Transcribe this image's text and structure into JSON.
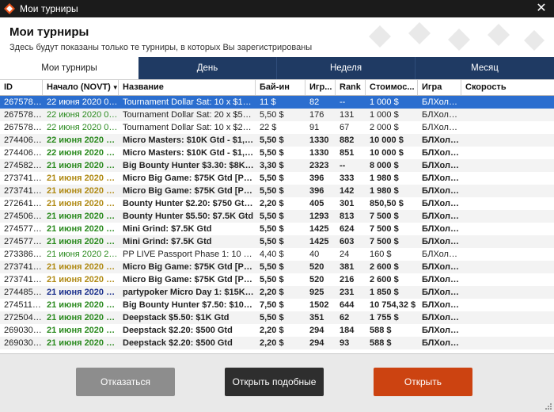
{
  "window": {
    "title": "Мои турниры",
    "close_glyph": "✕",
    "icon": "app-logo-icon"
  },
  "header": {
    "title": "Мои турниры",
    "subtitle": "Здесь будут показаны только те турниры, в которых Вы зарегистрированы"
  },
  "tabs": [
    {
      "label": "Мои турниры",
      "active": true
    },
    {
      "label": "День",
      "active": false
    },
    {
      "label": "Неделя",
      "active": false
    },
    {
      "label": "Месяц",
      "active": false
    }
  ],
  "table": {
    "columns": [
      "ID",
      "Начало (NOVT)",
      "Название",
      "Бай-ин",
      "Игр...",
      "Rank",
      "Стоимос...",
      "Игра",
      "Скорость"
    ],
    "sort_column": 1,
    "sort_glyph": "▼",
    "rows": [
      {
        "id": "2675785...",
        "date": "22 июня 2020 01...",
        "name": "Tournament Dollar Sat: 10 x $100 ...",
        "buyin": "11 $",
        "entrants": "82",
        "rank": "--",
        "cost": "1 000 $",
        "game": "БЛХолдем",
        "speed": "",
        "style": "normal",
        "date_color": "#2a8a1e"
      },
      {
        "id": "2675785...",
        "date": "22 июня 2020 00...",
        "name": "Tournament Dollar Sat: 20 x $50 G...",
        "buyin": "5,50 $",
        "entrants": "176",
        "rank": "131",
        "cost": "1 000 $",
        "game": "БЛХолдем",
        "speed": "",
        "style": "normal",
        "date_color": "#2a8a1e"
      },
      {
        "id": "2675787...",
        "date": "22 июня 2020 00...",
        "name": "Tournament Dollar Sat: 10 x $200 ...",
        "buyin": "22 $",
        "entrants": "91",
        "rank": "67",
        "cost": "2 000 $",
        "game": "БЛХолдем",
        "speed": "",
        "style": "normal",
        "date_color": "#2a8a1e"
      },
      {
        "id": "2744063...",
        "date": "22 июня 2020 00...",
        "name": "Micro Masters: $10K Gtd - $1,050...",
        "buyin": "5,50 $",
        "entrants": "1330",
        "rank": "882",
        "cost": "10 000 $",
        "game": "БЛХолдем",
        "speed": "",
        "style": "bold",
        "date_color": "#2a8a1e"
      },
      {
        "id": "2744063...",
        "date": "22 июня 2020 00...",
        "name": "Micro Masters: $10K Gtd - $1,050...",
        "buyin": "5,50 $",
        "entrants": "1330",
        "rank": "851",
        "cost": "10 000 $",
        "game": "БЛХолдем",
        "speed": "",
        "style": "bold",
        "date_color": "#2a8a1e"
      },
      {
        "id": "2745828...",
        "date": "21 июня 2020 23...",
        "name": "Big Bounty Hunter $3.30: $8K Gtd ...",
        "buyin": "3,30 $",
        "entrants": "2323",
        "rank": "--",
        "cost": "8 000 $",
        "game": "БЛХолдем",
        "speed": "",
        "style": "bold",
        "date_color": "#2a8a1e"
      },
      {
        "id": "2737419...",
        "date": "21 июня 2020 23...",
        "name": "Micro Big Game: $75K Gtd [Phase]",
        "buyin": "5,50 $",
        "entrants": "396",
        "rank": "333",
        "cost": "1 980 $",
        "game": "БЛХолдем",
        "speed": "",
        "style": "bold",
        "date_color": "#b08a14"
      },
      {
        "id": "2737419...",
        "date": "21 июня 2020 23...",
        "name": "Micro Big Game: $75K Gtd [Phase]",
        "buyin": "5,50 $",
        "entrants": "396",
        "rank": "142",
        "cost": "1 980 $",
        "game": "БЛХолдем",
        "speed": "",
        "style": "bold",
        "date_color": "#b08a14"
      },
      {
        "id": "2726419...",
        "date": "21 июня 2020 22...",
        "name": "Bounty Hunter $2.20: $750 Gtd [H...",
        "buyin": "2,20 $",
        "entrants": "405",
        "rank": "301",
        "cost": "850,50 $",
        "game": "БЛХолдем",
        "speed": "",
        "style": "bold",
        "date_color": "#b08a14"
      },
      {
        "id": "2745061...",
        "date": "21 июня 2020 22...",
        "name": "Bounty Hunter $5.50: $7.5K Gtd",
        "buyin": "5,50 $",
        "entrants": "1293",
        "rank": "813",
        "cost": "7 500 $",
        "game": "БЛХолдем",
        "speed": "",
        "style": "bold",
        "date_color": "#2a8a1e"
      },
      {
        "id": "2745771...",
        "date": "21 июня 2020 22...",
        "name": "Mini Grind: $7.5K Gtd",
        "buyin": "5,50 $",
        "entrants": "1425",
        "rank": "624",
        "cost": "7 500 $",
        "game": "БЛХолдем",
        "speed": "",
        "style": "bold",
        "date_color": "#2a8a1e"
      },
      {
        "id": "2745771...",
        "date": "21 июня 2020 22...",
        "name": "Mini Grind: $7.5K Gtd",
        "buyin": "5,50 $",
        "entrants": "1425",
        "rank": "603",
        "cost": "7 500 $",
        "game": "БЛХолдем",
        "speed": "",
        "style": "bold",
        "date_color": "#2a8a1e"
      },
      {
        "id": "2733862...",
        "date": "21 июня 2020 21...",
        "name": "PP LIVE Passport Phase 1: 10 x $...",
        "buyin": "4,40 $",
        "entrants": "40",
        "rank": "24",
        "cost": "160 $",
        "game": "БЛХолдем",
        "speed": "",
        "style": "normal",
        "date_color": "#2a8a1e"
      },
      {
        "id": "2737413...",
        "date": "21 июня 2020 21...",
        "name": "Micro Big Game: $75K Gtd [Phase]",
        "buyin": "5,50 $",
        "entrants": "520",
        "rank": "381",
        "cost": "2 600 $",
        "game": "БЛХолдем",
        "speed": "",
        "style": "bold",
        "date_color": "#b08a14"
      },
      {
        "id": "2737413...",
        "date": "21 июня 2020 21...",
        "name": "Micro Big Game: $75K Gtd [Phase]",
        "buyin": "5,50 $",
        "entrants": "520",
        "rank": "216",
        "cost": "2 600 $",
        "game": "БЛХолдем",
        "speed": "",
        "style": "bold",
        "date_color": "#b08a14"
      },
      {
        "id": "2744855...",
        "date": "21 июня 2020 21...",
        "name": "partypoker Micro Day 1: $15K Gtd",
        "buyin": "2,20 $",
        "entrants": "925",
        "rank": "231",
        "cost": "1 850 $",
        "game": "БЛХолдем",
        "speed": "",
        "style": "bold",
        "date_color": "#1a2f8c"
      },
      {
        "id": "2745118...",
        "date": "21 июня 2020 20...",
        "name": "Big Bounty Hunter $7.50: $10K Gtd",
        "buyin": "7,50 $",
        "entrants": "1502",
        "rank": "644",
        "cost": "10 754,32 $",
        "game": "БЛХолдем",
        "speed": "",
        "style": "bold",
        "date_color": "#2a8a1e"
      },
      {
        "id": "2725041...",
        "date": "21 июня 2020 19...",
        "name": "Deepstack $5.50: $1K Gtd",
        "buyin": "5,50 $",
        "entrants": "351",
        "rank": "62",
        "cost": "1 755 $",
        "game": "БЛХолдем",
        "speed": "",
        "style": "bold",
        "date_color": "#2a8a1e"
      },
      {
        "id": "2690305...",
        "date": "21 июня 2020 18...",
        "name": "Deepstack $2.20: $500 Gtd",
        "buyin": "2,20 $",
        "entrants": "294",
        "rank": "184",
        "cost": "588 $",
        "game": "БЛХолдем",
        "speed": "",
        "style": "bold",
        "date_color": "#2a8a1e"
      },
      {
        "id": "2690305...",
        "date": "21 июня 2020 18...",
        "name": "Deepstack $2.20: $500 Gtd",
        "buyin": "2,20 $",
        "entrants": "294",
        "rank": "93",
        "cost": "588 $",
        "game": "БЛХолдем",
        "speed": "",
        "style": "bold",
        "date_color": "#2a8a1e"
      }
    ],
    "selected_row": 0
  },
  "footer": {
    "decline_label": "Отказаться",
    "similar_label": "Открыть подобные",
    "open_label": "Открыть"
  },
  "colors": {
    "titlebar": "#1b1b1b",
    "tabs_bg": "#1f3a63",
    "selected_row": "#2b6ecf",
    "open_button": "#cc4311",
    "similar_button": "#2e2e2e",
    "decline_button": "#8d8d8d"
  }
}
